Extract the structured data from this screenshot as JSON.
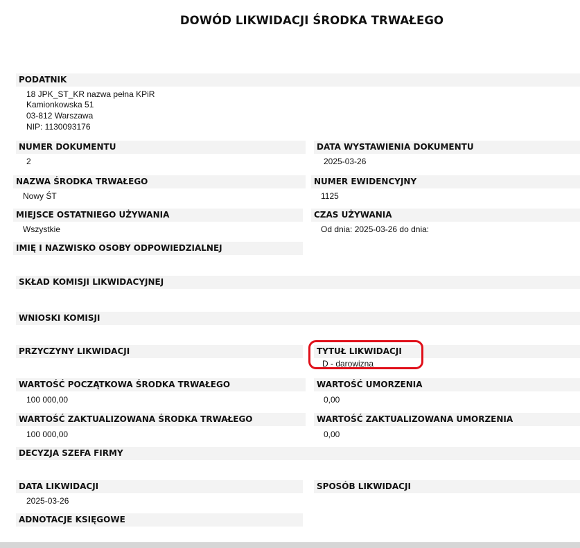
{
  "document": {
    "title": "DOWÓD LIKWIDACJI ŚRODKA TRWAŁEGO"
  },
  "taxpayer": {
    "label": "PODATNIK",
    "name": "18 JPK_ST_KR nazwa pełna KPiR",
    "street": "Kamionkowska 51",
    "city": "03-812 Warszawa",
    "nip": "NIP: 1130093176"
  },
  "fields": {
    "doc_number_label": "NUMER DOKUMENTU",
    "doc_number": "2",
    "issue_date_label": "DATA WYSTAWIENIA DOKUMENTU",
    "issue_date": "2025-03-26",
    "asset_name_label": "NAZWA ŚRODKA TRWAŁEGO",
    "asset_name": "Nowy ŚT",
    "inventory_number_label": "NUMER EWIDENCYJNY",
    "inventory_number": "1125",
    "last_use_place_label": "MIEJSCE OSTATNIEGO UŻYWANIA",
    "last_use_place": "Wszystkie",
    "usage_time_label": "CZAS UŻYWANIA",
    "usage_time": "Od dnia: 2025-03-26 do dnia:",
    "responsible_person_label": "IMIĘ I NAZWISKO OSOBY ODPOWIEDZIALNEJ",
    "commission_label": "SKŁAD KOMISJI LIKWIDACYJNEJ",
    "commission_conclusions_label": "WNIOSKI KOMISJI",
    "liquidation_reasons_label": "PRZYCZYNY LIKWIDACJI",
    "liquidation_title_label": "TYTUŁ LIKWIDACJI",
    "liquidation_title": "D - darowizna",
    "initial_value_label": "WARTOŚĆ POCZĄTKOWA ŚRODKA TRWAŁEGO",
    "initial_value": "100 000,00",
    "depreciation_label": "WARTOŚĆ UMORZENIA",
    "depreciation": "0,00",
    "updated_value_label": "WARTOŚĆ ZAKTUALIZOWANA ŚRODKA TRWAŁEGO",
    "updated_value": "100 000,00",
    "updated_depreciation_label": "WARTOŚĆ ZAKTUALIZOWANA UMORZENIA",
    "updated_depreciation": "0,00",
    "ceo_decision_label": "DECYZJA SZEFA FIRMY",
    "liquidation_date_label": "DATA LIKWIDACJI",
    "liquidation_date": "2025-03-26",
    "liquidation_method_label": "SPOSÓB LIKWIDACJI",
    "accounting_notes_label": "ADNOTACJE KSIĘGOWE"
  },
  "colors": {
    "header_bg": "#f3f3f3",
    "highlight": "#e0101a"
  }
}
